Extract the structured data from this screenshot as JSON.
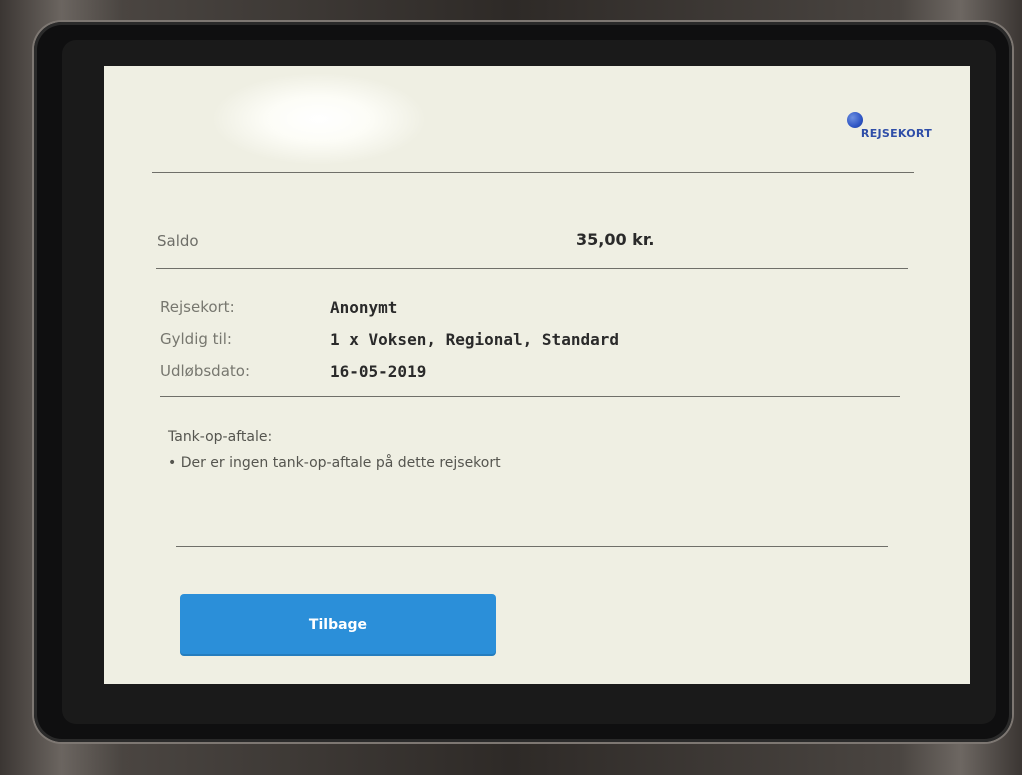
{
  "brand": {
    "logo_text": "REJSEKORT",
    "accent_color": "#2f4ea8"
  },
  "balance": {
    "label": "Saldo",
    "value": "35,00 kr."
  },
  "card_info": [
    {
      "label": "Rejsekort:",
      "value": "Anonymt"
    },
    {
      "label": "Gyldig til:",
      "value": "1 x Voksen, Regional, Standard"
    },
    {
      "label": "Udløbsdato:",
      "value": "16-05-2019"
    }
  ],
  "auto_topup": {
    "title": "Tank-op-aftale:",
    "bullet": "• Der er ingen tank-op-aftale på dette rejsekort"
  },
  "actions": {
    "back_label": "Tilbage",
    "back_color": "#2b8fd9"
  }
}
